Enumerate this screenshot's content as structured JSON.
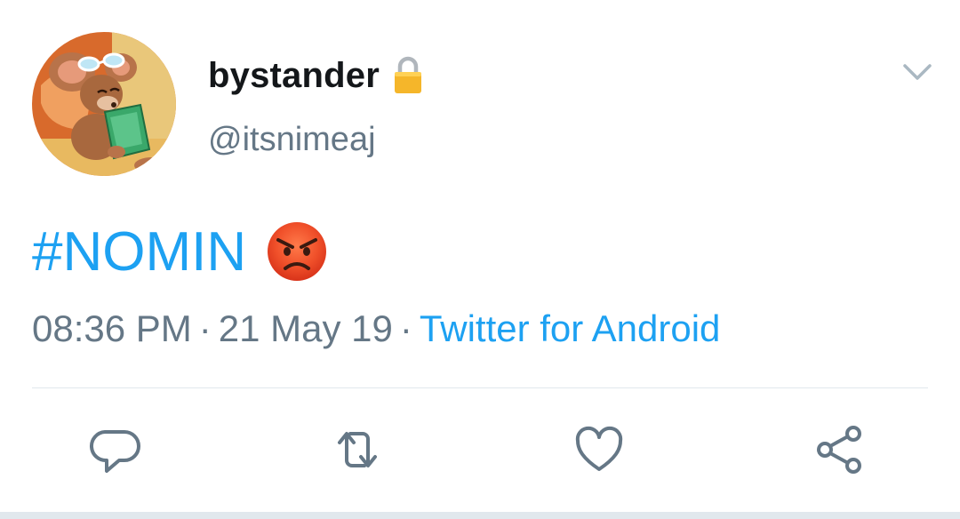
{
  "user": {
    "display_name": "bystander",
    "handle": "@itsnimeaj",
    "avatar_icon": "cartoon-mouse-reading-avatar",
    "protected_icon": "lock-icon"
  },
  "tweet": {
    "hashtag": "#NOMIN",
    "emoji_icon": "angry-face-emoji"
  },
  "meta": {
    "time": "08:36 PM",
    "separator": "·",
    "date": "21 May 19",
    "source": "Twitter for Android"
  },
  "actions": [
    {
      "name": "reply",
      "icon": "reply-icon"
    },
    {
      "name": "retweet",
      "icon": "retweet-icon"
    },
    {
      "name": "like",
      "icon": "heart-icon"
    },
    {
      "name": "share",
      "icon": "share-icon"
    }
  ],
  "colors": {
    "link": "#1da1f2",
    "secondary_text": "#657786",
    "primary_text": "#14171a",
    "divider": "#e1e8ed",
    "icon": "#657786"
  }
}
